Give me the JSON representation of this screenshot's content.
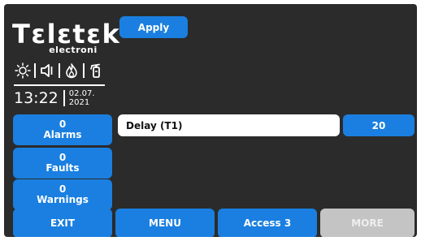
{
  "logo": {
    "brand": "Tεlεtεk",
    "sub": "electroni"
  },
  "status_icons": [
    "sun-icon",
    "speaker-icon",
    "fire-icon",
    "extinguisher-icon"
  ],
  "clock": {
    "time": "13:22",
    "date_line1": "02.07.",
    "date_line2": "2021"
  },
  "toolbar": {
    "apply_label": "Apply"
  },
  "counters": {
    "alarms": {
      "count": "0",
      "label": "Alarms"
    },
    "faults": {
      "count": "0",
      "label": "Faults"
    },
    "warnings": {
      "count": "0",
      "label": "Warnings"
    }
  },
  "parameter": {
    "name": "Delay (T1)",
    "value": "20"
  },
  "bottom_bar": {
    "exit": "EXIT",
    "menu": "MENU",
    "access": "Access 3",
    "more": "MORE"
  },
  "colors": {
    "background": "#2b2b2b",
    "button": "#1a7fe0",
    "disabled_button": "#c4c4c4",
    "field": "#ffffff"
  }
}
